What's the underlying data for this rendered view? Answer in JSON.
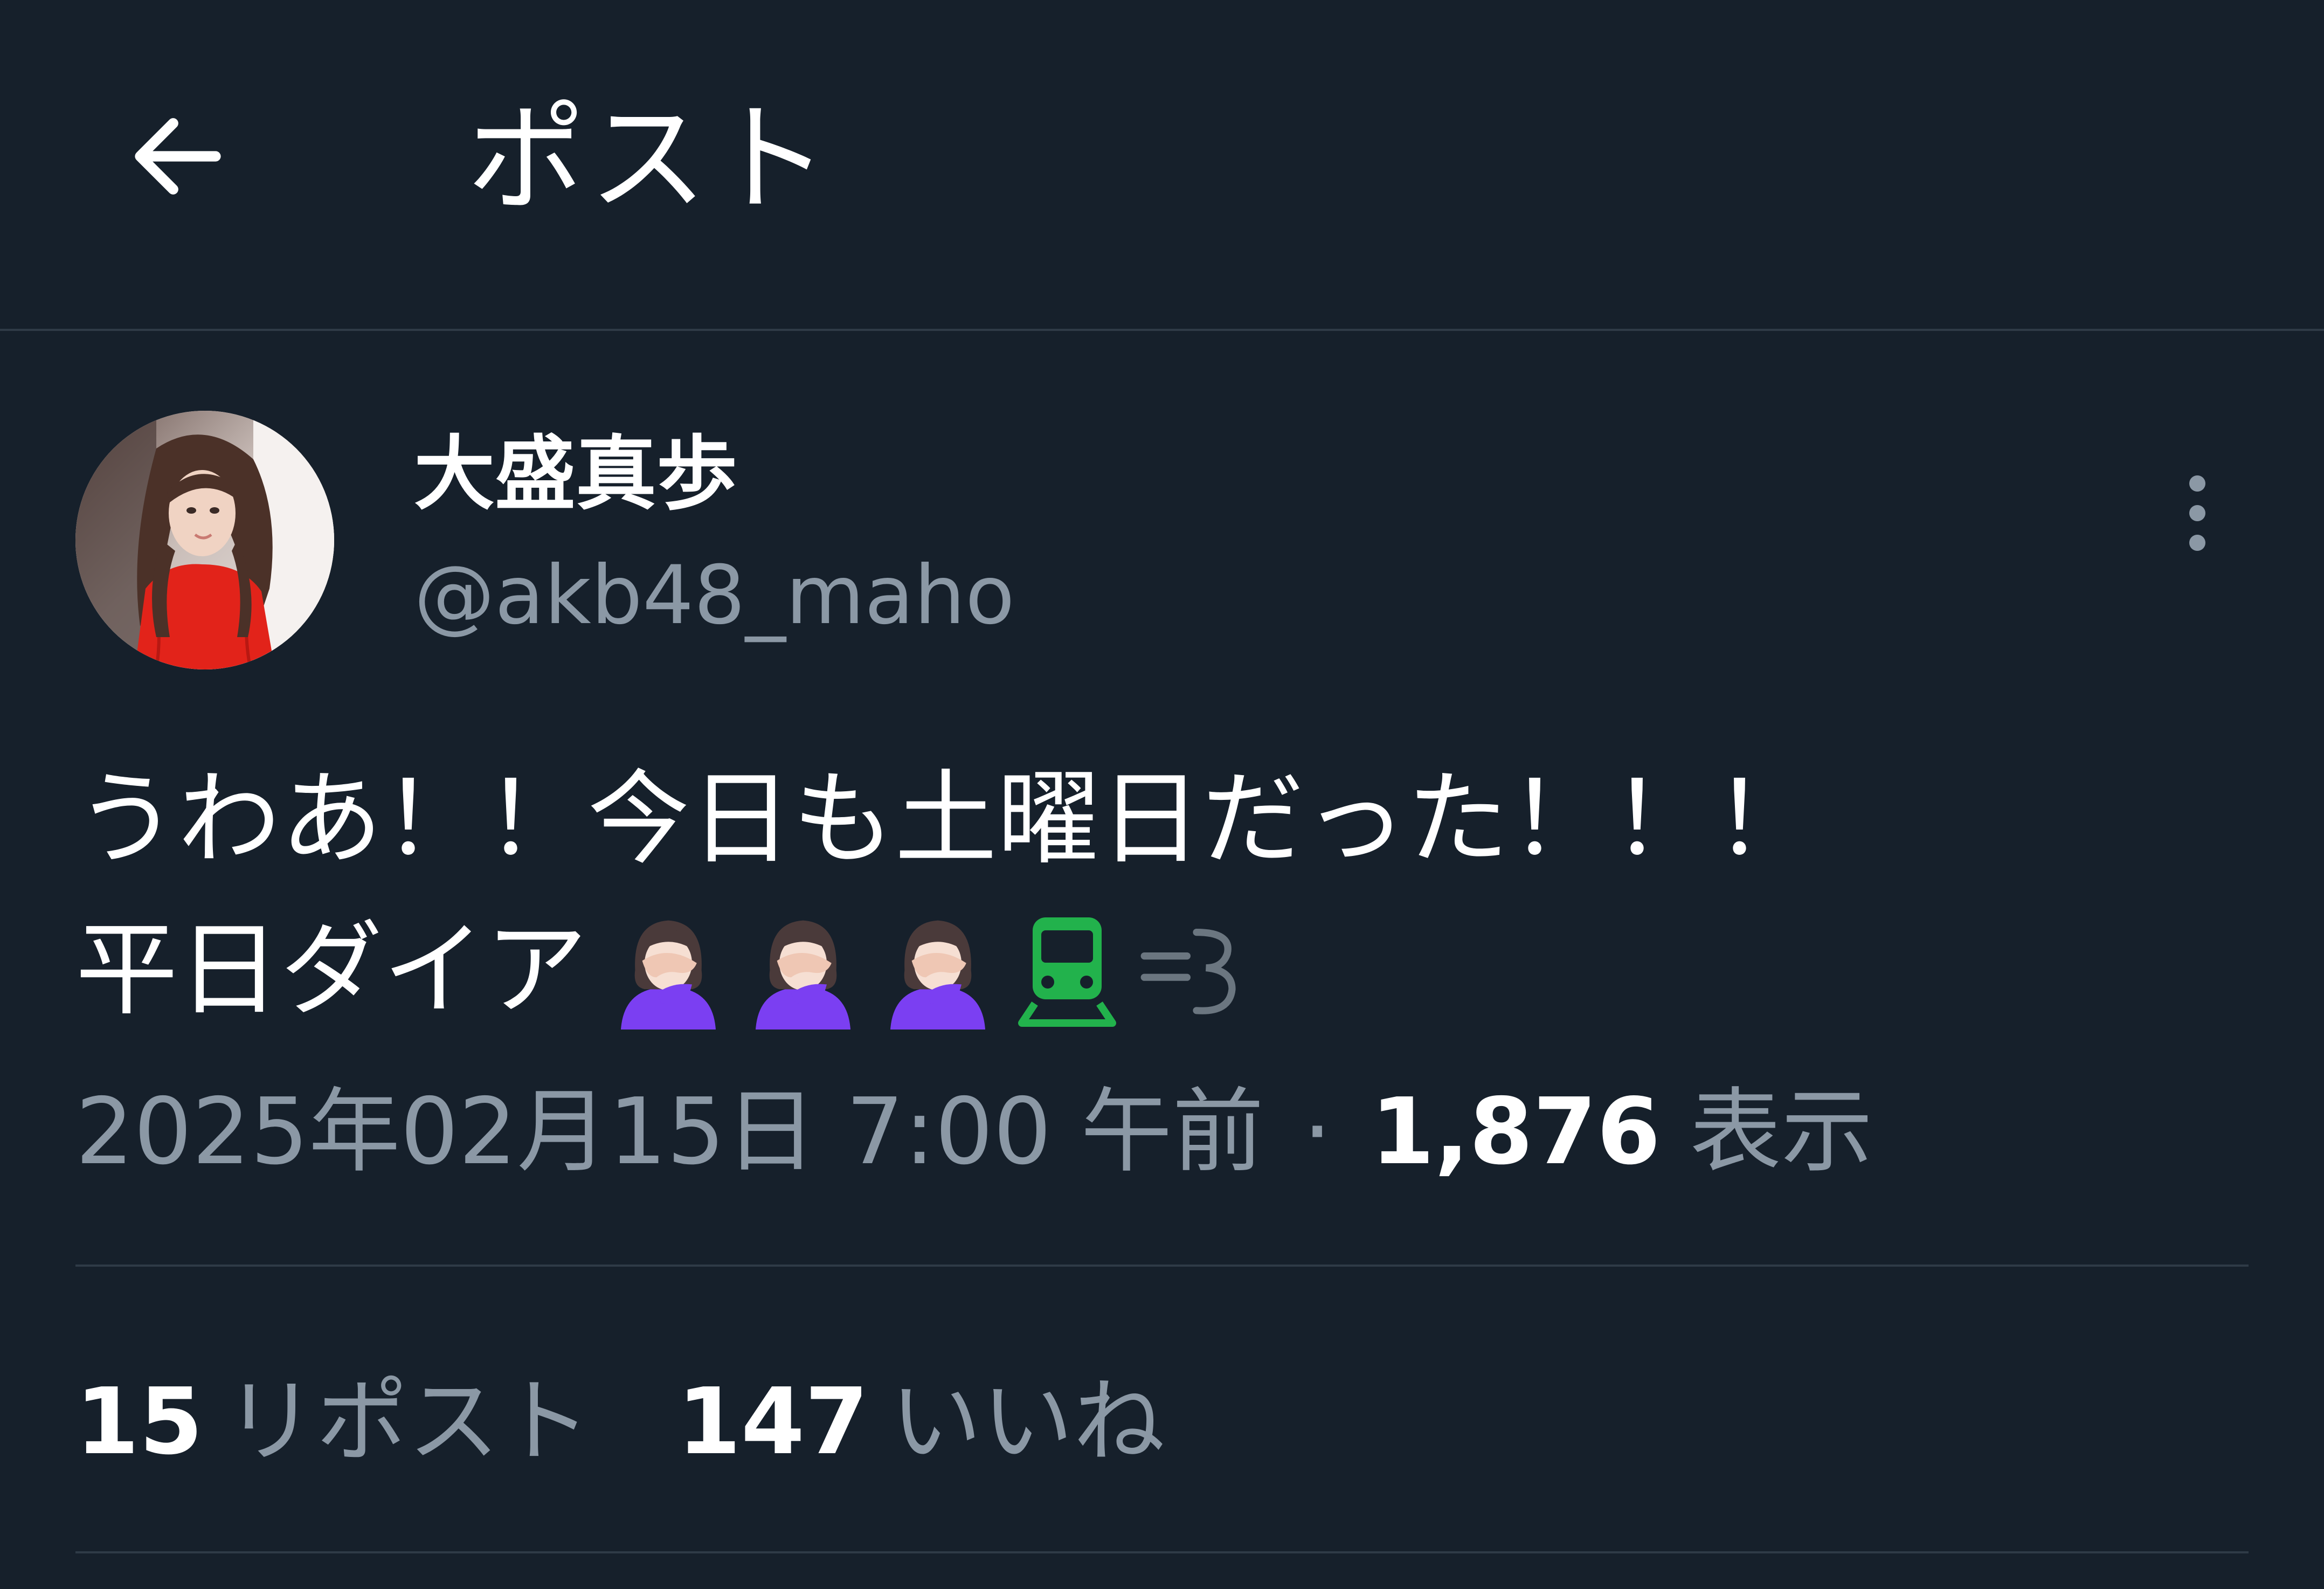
{
  "header": {
    "back_icon": "arrow-left-icon",
    "title": "ポスト"
  },
  "author": {
    "display_name": "大盛真歩",
    "handle": "@akb48_maho"
  },
  "post": {
    "line1": "うわあ！！今日も土曜日だった！！！",
    "line2_text": "平日ダイア",
    "line2_emoji": [
      "person-facepalming-emoji",
      "person-facepalming-emoji",
      "person-facepalming-emoji",
      "train-emoji",
      "dash-emoji"
    ]
  },
  "meta": {
    "timestamp": "2025年02月15日 7:00 午前",
    "separator": "·",
    "views_count": "1,876",
    "views_label": "表示"
  },
  "stats": {
    "reposts_count": "15",
    "reposts_label": "リポスト",
    "likes_count": "147",
    "likes_label": "いいね"
  },
  "colors": {
    "background": "#16202b",
    "text_primary": "#ffffff",
    "text_secondary": "#8b98a5",
    "divider": "#2f3b47",
    "train_green": "#22b24c",
    "emoji_purple": "#7b3ff2"
  }
}
